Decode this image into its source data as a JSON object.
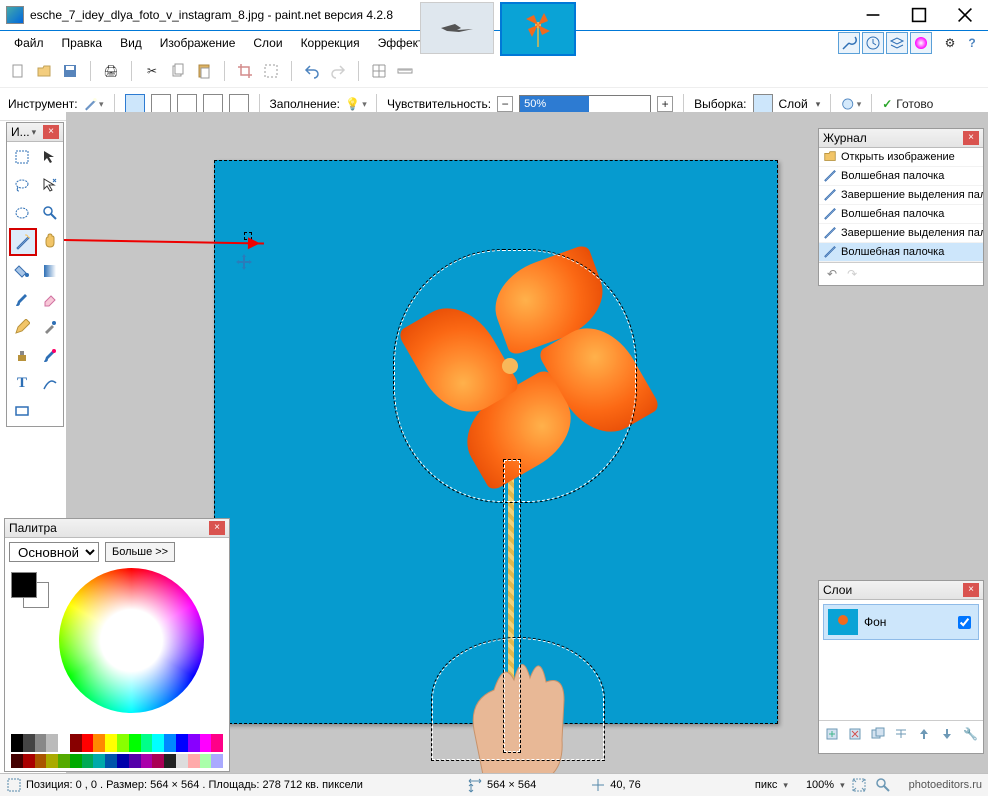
{
  "title": "esche_7_idey_dlya_foto_v_instagram_8.jpg - paint.net версия 4.2.8",
  "menu": {
    "file": "Файл",
    "edit": "Правка",
    "view": "Вид",
    "image": "Изображение",
    "layers": "Слои",
    "adjust": "Коррекция",
    "effects": "Эффекты"
  },
  "toolbar2": {
    "instrument": "Инструмент:",
    "fill": "Заполнение:",
    "tolerance": "Чувствительность:",
    "tolerance_val": "50%",
    "selection": "Выборка:",
    "selection_val": "Слой",
    "ready": "Готово"
  },
  "tools_title": "И...",
  "history": {
    "title": "Журнал",
    "items": [
      {
        "label": "Открыть изображение",
        "icon": "open"
      },
      {
        "label": "Волшебная палочка",
        "icon": "wand"
      },
      {
        "label": "Завершение выделения палочкой",
        "icon": "wand"
      },
      {
        "label": "Волшебная палочка",
        "icon": "wand"
      },
      {
        "label": "Завершение выделения палочкой",
        "icon": "wand"
      },
      {
        "label": "Волшебная палочка",
        "icon": "wand",
        "sel": true
      }
    ]
  },
  "layers": {
    "title": "Слои",
    "bg": "Фон"
  },
  "palette": {
    "title": "Палитра",
    "primary": "Основной",
    "more": "Больше >>"
  },
  "status": {
    "pos": "Позиция: 0 , 0 . Размер: 564  × 564 . Площадь: 278 712 кв. пиксели",
    "dim": "564 × 564",
    "cursor": "40, 76",
    "unit": "пикс",
    "zoom": "100%",
    "site": "photoeditors.ru"
  },
  "palette_colors": [
    "#000",
    "#444",
    "#888",
    "#bbb",
    "#fff",
    "#800",
    "#f00",
    "#f80",
    "#ff0",
    "#8f0",
    "#0f0",
    "#0f8",
    "#0ff",
    "#08f",
    "#00f",
    "#80f",
    "#f0f",
    "#f08"
  ],
  "palette_colors2": [
    "#400",
    "#a00",
    "#a50",
    "#aa0",
    "#5a0",
    "#0a0",
    "#0a5",
    "#0aa",
    "#05a",
    "#00a",
    "#50a",
    "#a0a",
    "#a05",
    "#222",
    "#ddd",
    "#faa",
    "#afa",
    "#aaf"
  ]
}
